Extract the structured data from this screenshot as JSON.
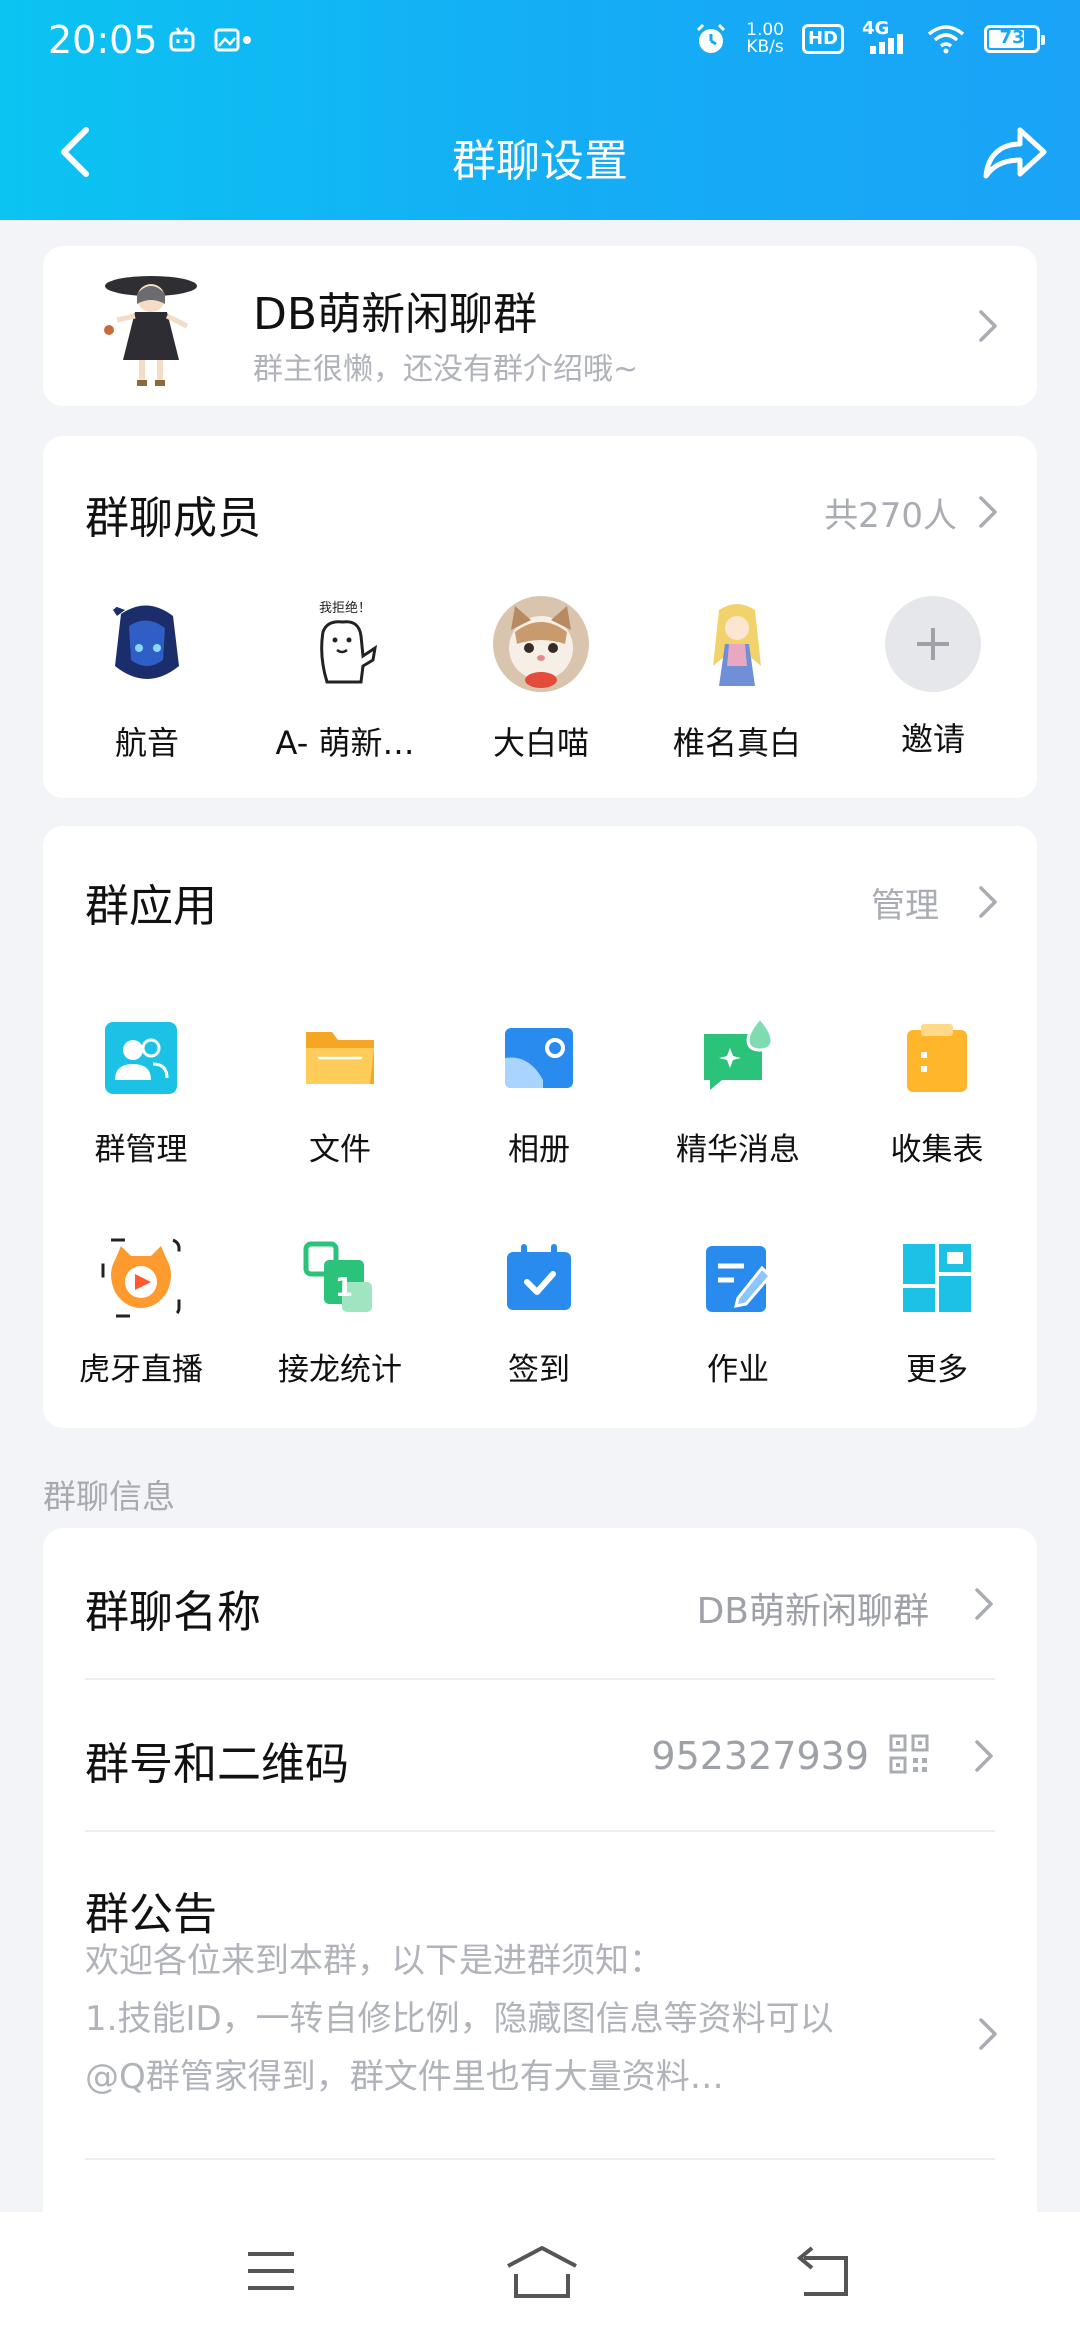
{
  "status": {
    "time": "20:05",
    "net_speed_value": "1.00",
    "net_speed_unit": "KB/s",
    "hd": "HD",
    "signal": "4G",
    "battery": "73"
  },
  "header": {
    "title": "群聊设置",
    "back_icon": "chevron-left-icon",
    "share_icon": "share-icon"
  },
  "group": {
    "name": "DB萌新闲聊群",
    "intro": "群主很懒，还没有群介绍哦~"
  },
  "members": {
    "title": "群聊成员",
    "count": "共270人",
    "items": [
      {
        "name": "航音"
      },
      {
        "name": "A- 萌新…"
      },
      {
        "name": "大白喵"
      },
      {
        "name": "椎名真白"
      }
    ],
    "invite_label": "邀请",
    "sticker_text": "我拒绝！"
  },
  "apps": {
    "title": "群应用",
    "manage": "管理",
    "items": [
      {
        "name": "群管理",
        "icon": "group-manage-icon",
        "color": "#1cc2e6"
      },
      {
        "name": "文件",
        "icon": "folder-icon",
        "color": "#ffbe3c"
      },
      {
        "name": "相册",
        "icon": "album-icon",
        "color": "#2a8bef"
      },
      {
        "name": "精华消息",
        "icon": "essence-message-icon",
        "color": "#2bc27a"
      },
      {
        "name": "收集表",
        "icon": "collect-form-icon",
        "color": "#ffb62a"
      },
      {
        "name": "虎牙直播",
        "icon": "huya-live-icon",
        "color": "#ff9a2e"
      },
      {
        "name": "接龙统计",
        "icon": "relay-stats-icon",
        "color": "#2bc27a"
      },
      {
        "name": "签到",
        "icon": "checkin-icon",
        "color": "#2a8bef"
      },
      {
        "name": "作业",
        "icon": "homework-icon",
        "color": "#2a8bef"
      },
      {
        "name": "更多",
        "icon": "more-apps-icon",
        "color": "#1cc2e6"
      }
    ],
    "relay_digit": "1"
  },
  "info": {
    "section_label": "群聊信息",
    "name_label": "群聊名称",
    "name_value": "DB萌新闲聊群",
    "id_label": "群号和二维码",
    "id_value": "952327939",
    "notice_label": "群公告",
    "notice_line1": "欢迎各位来到本群，以下是进群须知：",
    "notice_line2": "1.技能ID，一转自修比例，隐藏图信息等资料可以",
    "notice_line3": "@Q群管家得到，群文件里也有大量资料…"
  },
  "navbar": {
    "menu_icon": "menu-icon",
    "home_icon": "home-icon",
    "back_icon": "back-icon"
  }
}
